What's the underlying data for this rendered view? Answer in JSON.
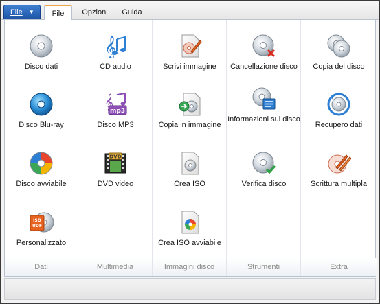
{
  "menubar": {
    "file_button": "File",
    "tabs": [
      "File",
      "Opzioni",
      "Guida"
    ],
    "active_tab": "File"
  },
  "groups": [
    {
      "title": "Dati",
      "items": [
        {
          "label": "Disco dati",
          "icon": "disc-icon"
        },
        {
          "label": "Disco Blu-ray",
          "icon": "bluray-disc-icon"
        },
        {
          "label": "Disco avviabile",
          "icon": "bootable-disc-icon"
        },
        {
          "label": "Personalizzato",
          "icon": "iso-udf-disc-icon"
        }
      ]
    },
    {
      "title": "Multimedia",
      "items": [
        {
          "label": "CD audio",
          "icon": "music-notes-icon"
        },
        {
          "label": "Disco MP3",
          "icon": "mp3-notes-icon"
        },
        {
          "label": "DVD video",
          "icon": "dvd-film-icon"
        }
      ]
    },
    {
      "title": "Immagini disco",
      "items": [
        {
          "label": "Scrivi immagine",
          "icon": "write-image-icon"
        },
        {
          "label": "Copia in immagine",
          "icon": "copy-to-image-icon"
        },
        {
          "label": "Crea ISO",
          "icon": "create-iso-icon"
        },
        {
          "label": "Crea ISO avviabile",
          "icon": "create-bootable-iso-icon"
        }
      ]
    },
    {
      "title": "Strumenti",
      "items": [
        {
          "label": "Cancellazione disco",
          "icon": "erase-disc-icon"
        },
        {
          "label": "Informazioni sul disco",
          "icon": "disc-info-icon"
        },
        {
          "label": "Verifica disco",
          "icon": "verify-disc-icon"
        }
      ]
    },
    {
      "title": "Extra",
      "items": [
        {
          "label": "Copia del disco",
          "icon": "copy-disc-icon"
        },
        {
          "label": "Recupero dati",
          "icon": "data-recovery-icon"
        },
        {
          "label": "Scrittura multipla",
          "icon": "multi-write-icon"
        }
      ]
    }
  ]
}
